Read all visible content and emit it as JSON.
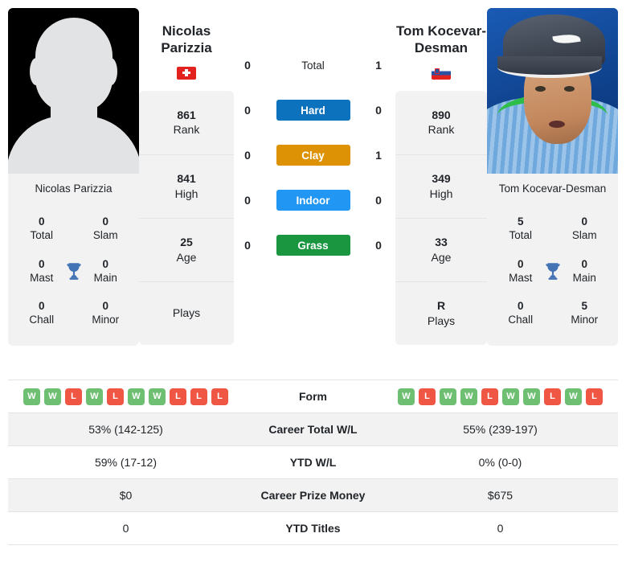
{
  "players": {
    "left": {
      "name_line1": "Nicolas",
      "name_line2": "Parizzia",
      "photo_caption": "Nicolas Parizzia",
      "country_code": "CH",
      "photo_type": "placeholder-silhouette",
      "stats": [
        {
          "value": "861",
          "label": "Rank"
        },
        {
          "value": "841",
          "label": "High"
        },
        {
          "value": "25",
          "label": "Age"
        },
        {
          "value": "",
          "label": "Plays"
        }
      ],
      "titles": [
        {
          "value": "0",
          "label": "Total"
        },
        {
          "value": "0",
          "label": "Slam"
        },
        {
          "value": "0",
          "label": "Mast"
        },
        {
          "value": "0",
          "label": "Main"
        },
        {
          "value": "0",
          "label": "Chall"
        },
        {
          "value": "0",
          "label": "Minor"
        }
      ],
      "form": [
        "W",
        "W",
        "L",
        "W",
        "L",
        "W",
        "W",
        "L",
        "L",
        "L"
      ],
      "career_total_wl": "53% (142-125)",
      "ytd_wl": "59% (17-12)",
      "career_prize_money": "$0",
      "ytd_titles": "0"
    },
    "right": {
      "name_line1": "Tom Kocevar-",
      "name_line2": "Desman",
      "photo_caption": "Tom Kocevar-Desman",
      "country_code": "SI",
      "photo_type": "photo",
      "stats": [
        {
          "value": "890",
          "label": "Rank"
        },
        {
          "value": "349",
          "label": "High"
        },
        {
          "value": "33",
          "label": "Age"
        },
        {
          "value": "R",
          "label": "Plays"
        }
      ],
      "titles": [
        {
          "value": "5",
          "label": "Total"
        },
        {
          "value": "0",
          "label": "Slam"
        },
        {
          "value": "0",
          "label": "Mast"
        },
        {
          "value": "0",
          "label": "Main"
        },
        {
          "value": "0",
          "label": "Chall"
        },
        {
          "value": "5",
          "label": "Minor"
        }
      ],
      "form": [
        "W",
        "L",
        "W",
        "W",
        "L",
        "W",
        "W",
        "L",
        "W",
        "L"
      ],
      "career_total_wl": "55% (239-197)",
      "ytd_wl": "0% (0-0)",
      "career_prize_money": "$675",
      "ytd_titles": "0"
    }
  },
  "h2h_surfaces": [
    {
      "label": "Total",
      "left": "0",
      "right": "1",
      "color": ""
    },
    {
      "label": "Hard",
      "left": "0",
      "right": "0",
      "color": "#0c72bd"
    },
    {
      "label": "Clay",
      "left": "0",
      "right": "1",
      "color": "#dd9105"
    },
    {
      "label": "Indoor",
      "left": "0",
      "right": "0",
      "color": "#2196f3"
    },
    {
      "label": "Grass",
      "left": "0",
      "right": "0",
      "color": "#1a9641"
    }
  ],
  "table_rows": [
    {
      "label": "Form",
      "type": "form"
    },
    {
      "label": "Career Total W/L",
      "type": "text",
      "key": "career_total_wl"
    },
    {
      "label": "YTD W/L",
      "type": "text",
      "key": "ytd_wl"
    },
    {
      "label": "Career Prize Money",
      "type": "text",
      "key": "career_prize_money"
    },
    {
      "label": "YTD Titles",
      "type": "text",
      "key": "ytd_titles"
    }
  ],
  "colors": {
    "win": "#6fbf73",
    "loss": "#ef5744",
    "trophy": "#4273b5",
    "panel": "#f2f2f2"
  }
}
